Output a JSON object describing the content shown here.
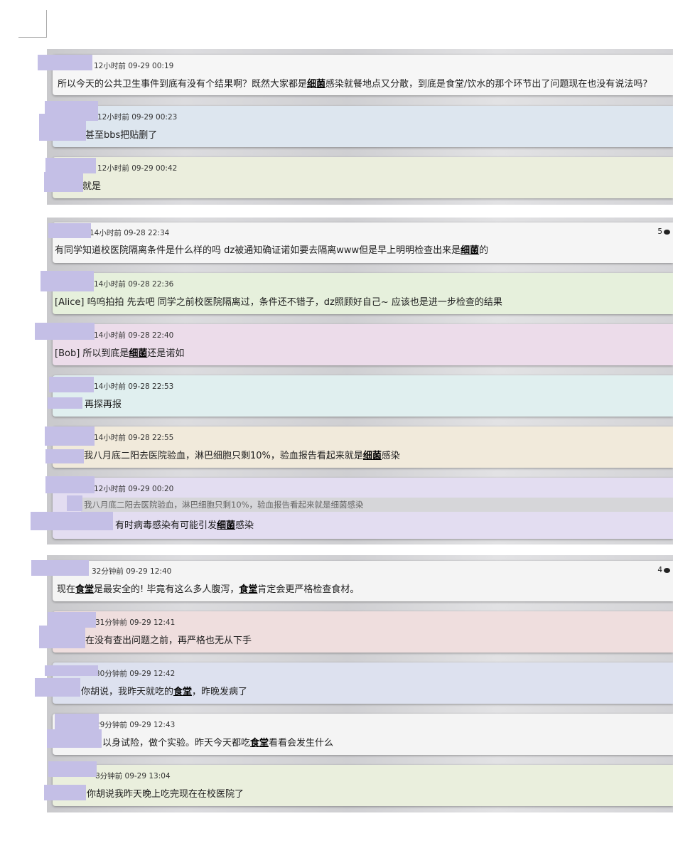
{
  "threads": [
    {
      "replies": [
        {
          "time": "12小时前 09-29 00:19",
          "parts": [
            {
              "t": "所以今天的公共卫生事件到底有没有个结果啊？既然大家都是"
            },
            {
              "t": "细菌",
              "kw": true
            },
            {
              "t": "感染就餐地点又分散，到底是食堂/饮水的那个环节出了问题现在也没有说法吗?"
            }
          ]
        },
        {
          "time": "12小时前 09-29 00:23",
          "parts": [
            {
              "t": "甚至bbs把贴删了"
            }
          ]
        },
        {
          "time": "12小时前 09-29 00:42",
          "parts": [
            {
              "t": "就是"
            }
          ]
        }
      ]
    },
    {
      "reply_count": "5",
      "replies": [
        {
          "time": "14小时前 09-28 22:34",
          "parts": [
            {
              "t": "有同学知道校医院隔离条件是什么样的吗 dz被通知确证诺如要去隔离www但是早上明明检查出来是"
            },
            {
              "t": "细菌",
              "kw": true
            },
            {
              "t": "的"
            }
          ]
        },
        {
          "time": "14小时前 09-28 22:36",
          "parts": [
            {
              "t": "[Alice] 呜呜拍拍 先去吧 同学之前校医院隔离过，条件还不错子，dz照顾好自己~ 应该也是进一步检查的结果"
            }
          ]
        },
        {
          "time": "14小时前 09-28 22:40",
          "parts": [
            {
              "t": "[Bob] 所以到底是"
            },
            {
              "t": "细菌",
              "kw": true
            },
            {
              "t": "还是诺如"
            }
          ]
        },
        {
          "time": "14小时前 09-28 22:53",
          "parts": [
            {
              "t": "再探再报"
            }
          ]
        },
        {
          "time": "14小时前 09-28 22:55",
          "parts": [
            {
              "t": "我八月底二阳去医院验血，淋巴细胞只剩10%，验血报告看起来就是"
            },
            {
              "t": "细菌",
              "kw": true
            },
            {
              "t": "感染"
            }
          ]
        },
        {
          "time": "12小时前 09-29 00:20",
          "quote": "我八月底二阳去医院验血，淋巴细胞只剩10%，验血报告看起来就是细菌感染",
          "parts": [
            {
              "t": "有时病毒感染有可能引发"
            },
            {
              "t": "细菌",
              "kw": true
            },
            {
              "t": "感染"
            }
          ]
        }
      ]
    },
    {
      "reply_count": "4",
      "replies": [
        {
          "time": "32分钟前 09-29 12:40",
          "parts": [
            {
              "t": "现在"
            },
            {
              "t": "食堂",
              "kw": true
            },
            {
              "t": "是最安全的! 毕竟有这么多人腹泻，"
            },
            {
              "t": "食堂",
              "kw": true
            },
            {
              "t": "肯定会更严格检查食材。"
            }
          ]
        },
        {
          "time": "31分钟前 09-29 12:41",
          "parts": [
            {
              "t": "在没有查出问题之前，再严格也无从下手"
            }
          ]
        },
        {
          "time": "30分钟前 09-29 12:42",
          "parts": [
            {
              "t": "你胡说，我昨天就吃的"
            },
            {
              "t": "食堂",
              "kw": true
            },
            {
              "t": "，昨晚发病了"
            }
          ]
        },
        {
          "time": "29分钟前 09-29 12:43",
          "parts": [
            {
              "t": "以身试险，做个实验。昨天今天都吃"
            },
            {
              "t": "食堂",
              "kw": true
            },
            {
              "t": "看看会发生什么"
            }
          ]
        },
        {
          "time": "8分钟前 09-29 13:04",
          "parts": [
            {
              "t": "你胡说我昨天晚上吃完现在在校医院了"
            }
          ]
        }
      ]
    }
  ],
  "colors": {
    "redaction": "#c4bfe6",
    "keyword": "#000000",
    "card_bg": [
      "#f6f6f6",
      "#dde6ef",
      "#ebeedd",
      "#f5f5f5",
      "#e6f0dc",
      "#ecdcea",
      "#e0efef",
      "#f1eadb",
      "#e3ddf1",
      "#f4f4f4",
      "#efdede",
      "#dde1ef",
      "#f4f4f4",
      "#eaefdd"
    ]
  },
  "icons": {
    "reply_count": "speech-bubble-icon"
  }
}
